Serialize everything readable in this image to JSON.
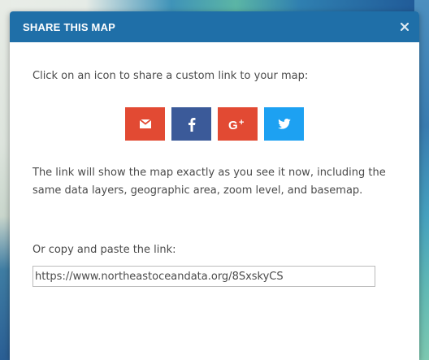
{
  "modal": {
    "title": "SHARE THIS MAP",
    "close_icon": "close-icon",
    "intro": "Click on an icon to share a custom link to your map:",
    "share_buttons": [
      {
        "name": "email",
        "icon": "envelope-icon",
        "color": "#e24a33"
      },
      {
        "name": "facebook",
        "icon": "facebook-icon",
        "label": "f",
        "color": "#3b5a99"
      },
      {
        "name": "google-plus",
        "icon": "google-plus-icon",
        "label": "G+",
        "color": "#e24a33"
      },
      {
        "name": "twitter",
        "icon": "twitter-icon",
        "color": "#1da1f2"
      }
    ],
    "description": "The link will show the map exactly as you see it now, including the same data layers, geographic area, zoom level, and basemap.",
    "copy_label": "Or copy and paste the link:",
    "link_value": "https://www.northeastoceandata.org/8SxskyCS"
  },
  "colors": {
    "header": "#1f6fa8",
    "header_text": "#ffffff",
    "body_text": "#4a4a4a"
  }
}
